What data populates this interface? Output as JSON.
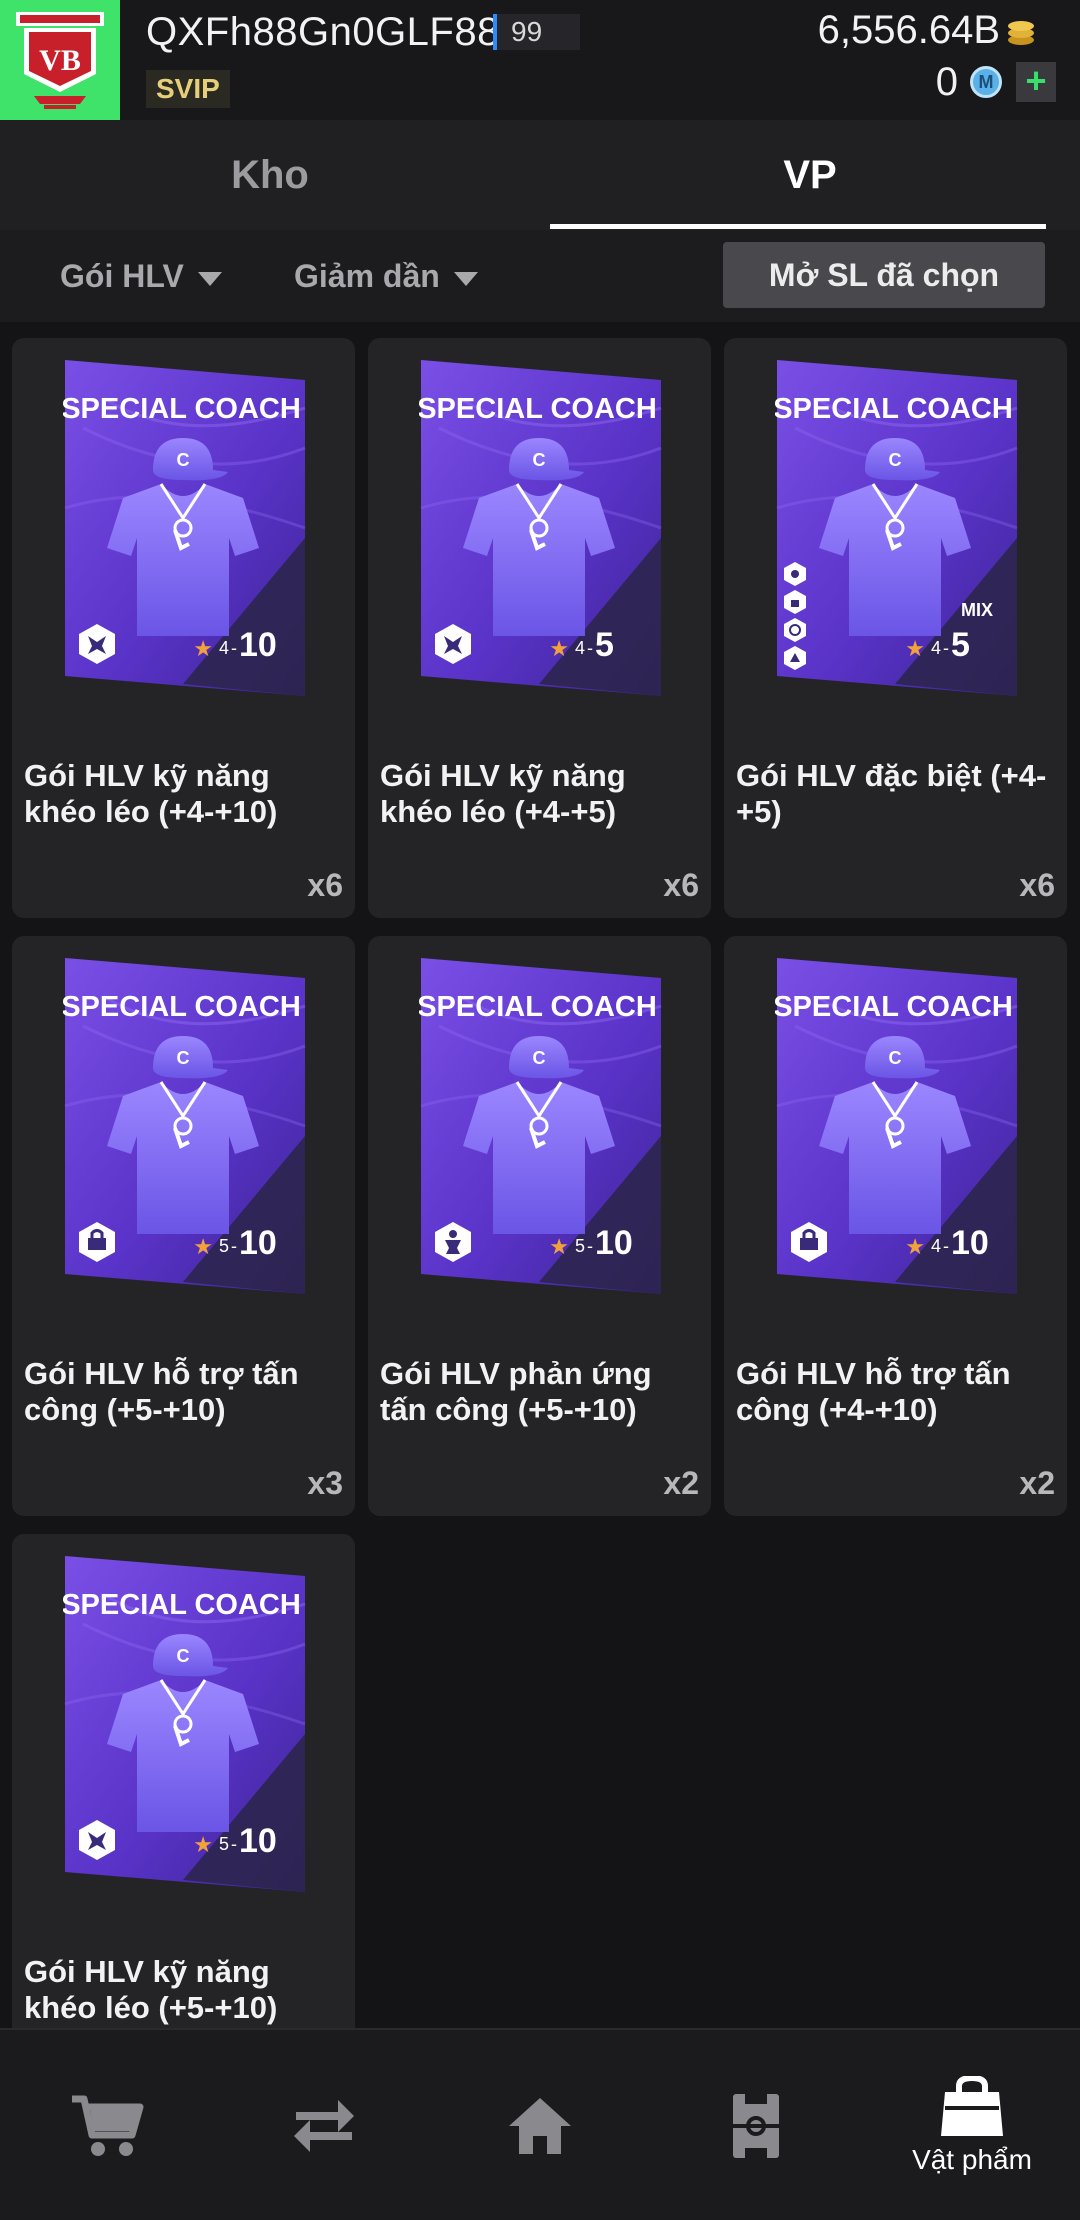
{
  "header": {
    "username": "QXFh88Gn0GLF88",
    "level": "99",
    "vip_badge": "SVIP",
    "coins": "6,556.64B",
    "m_points": "0",
    "m_icon_letter": "M",
    "plus_label": "+",
    "logo_text": "VB",
    "logo_color": "#3fe36a"
  },
  "tabs": [
    {
      "label": "Kho",
      "active": false
    },
    {
      "label": "VP",
      "active": true
    }
  ],
  "filters": {
    "type_label": "Gói HLV",
    "sort_label": "Giảm dần",
    "open_selected_label": "Mở SL đã chọn"
  },
  "card_title": "SPECIAL COACH",
  "card_cap_letter": "C",
  "mix_label": "MIX",
  "items": [
    {
      "name": "Gói HLV kỹ năng khéo léo (+4-+10)",
      "qty": "x6",
      "star_min": "4",
      "star_max": "10",
      "icon": "skill-icon"
    },
    {
      "name": "Gói HLV kỹ năng khéo léo (+4-+5)",
      "qty": "x6",
      "star_min": "4",
      "star_max": "5",
      "icon": "skill-icon"
    },
    {
      "name": "Gói HLV đặc biệt (+4-+5)",
      "qty": "x6",
      "star_min": "4",
      "star_max": "5",
      "icon": "mix-icon"
    },
    {
      "name": "Gói HLV hỗ trợ tấn công (+5-+10)",
      "qty": "x3",
      "star_min": "5",
      "star_max": "10",
      "icon": "attack-support-icon"
    },
    {
      "name": "Gói HLV phản ứng tấn công (+5-+10)",
      "qty": "x2",
      "star_min": "5",
      "star_max": "10",
      "icon": "attack-reaction-icon"
    },
    {
      "name": "Gói HLV hỗ trợ tấn công (+4-+10)",
      "qty": "x2",
      "star_min": "4",
      "star_max": "10",
      "icon": "attack-support-icon"
    },
    {
      "name": "Gói HLV kỹ năng khéo léo (+5-+10)",
      "qty": "",
      "star_min": "5",
      "star_max": "10",
      "icon": "skill-icon"
    }
  ],
  "bottom_nav": [
    {
      "icon": "cart-icon",
      "label": ""
    },
    {
      "icon": "transfer-icon",
      "label": ""
    },
    {
      "icon": "home-icon",
      "label": ""
    },
    {
      "icon": "formation-icon",
      "label": ""
    },
    {
      "icon": "bag-icon",
      "label": "Vật phẩm"
    }
  ],
  "colors": {
    "card_purple": "#6a3fd8",
    "card_dark": "#2a1f5c",
    "star": "#f2a23a",
    "accent_green": "#37e06a",
    "tab_underline": "#ffffff"
  }
}
